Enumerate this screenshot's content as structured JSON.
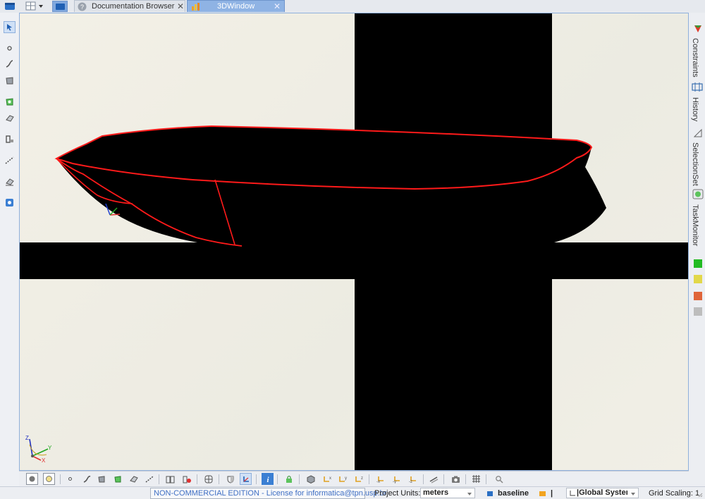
{
  "tabs": [
    {
      "label": "Documentation Browser",
      "close": "✕"
    },
    {
      "label": "3DWindow",
      "close": "✕"
    }
  ],
  "right_panel": {
    "tabs": [
      {
        "label": "Constraints",
        "icon": "constraints-icon"
      },
      {
        "label": "History",
        "icon": "history-icon"
      },
      {
        "label": "SelectionSet",
        "icon": "selection-set-icon"
      },
      {
        "label": "TaskMonitor",
        "icon": "task-monitor-icon"
      }
    ],
    "swatches": [
      "#22bb22",
      "#e2d84a",
      "#e0653a",
      "#bdbdbd"
    ]
  },
  "viewport": {
    "background": "#f0eee5",
    "hull_fill": "#000000",
    "hull_outline": "#ff0000",
    "axes": {
      "x": "X",
      "y": "Y",
      "z": "Z"
    }
  },
  "status": {
    "license": "NON-COMMERCIAL EDITION - License for informatica@tpn.usp.br",
    "units_label": "Project Units:",
    "units_value": "meters",
    "baseline": "baseline",
    "pipe": "|",
    "system": "|Global Systen",
    "grid": "Grid Scaling: 1"
  }
}
